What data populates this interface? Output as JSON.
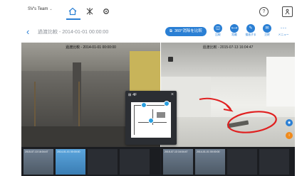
{
  "header": {
    "team_label": "SV's Team",
    "nav_icons": [
      "home-icon",
      "floorplan-icon",
      "gear-icon"
    ],
    "help_icon": "help-icon",
    "user_icon": "person-icon"
  },
  "subheader": {
    "title": "過渡比較 - 2014-01-01 00:00:00",
    "btn_360": "360°消除を比較",
    "tools": [
      {
        "label": "比較"
      },
      {
        "label": "距離"
      },
      {
        "label": "描画する"
      },
      {
        "label": "注釈"
      },
      {
        "label": "メニュー"
      }
    ],
    "accent": "#2a7fd4"
  },
  "left_pane": {
    "label": "過渡比較 - 2014-01-01 00:00:00"
  },
  "right_pane": {
    "label": "過渡比較 - 2015-07-13 16:04:47"
  },
  "minimap": {
    "title": "4F",
    "close": "×"
  },
  "left_strip": {
    "thumbs": [
      {
        "label": "2015-07-13 16:04:47",
        "selected": false
      },
      {
        "label": "2014-01-01 00:00:00",
        "selected": true
      },
      {
        "label": "",
        "selected": false
      },
      {
        "label": "",
        "selected": false
      }
    ]
  },
  "right_strip": {
    "thumbs": [
      {
        "label": "2015-07-13 16:04:47",
        "selected": false
      },
      {
        "label": "2014-01-01 00:00:00",
        "selected": false
      },
      {
        "label": "",
        "selected": false
      },
      {
        "label": "",
        "selected": false
      }
    ]
  },
  "annotation_color": "#e02020"
}
